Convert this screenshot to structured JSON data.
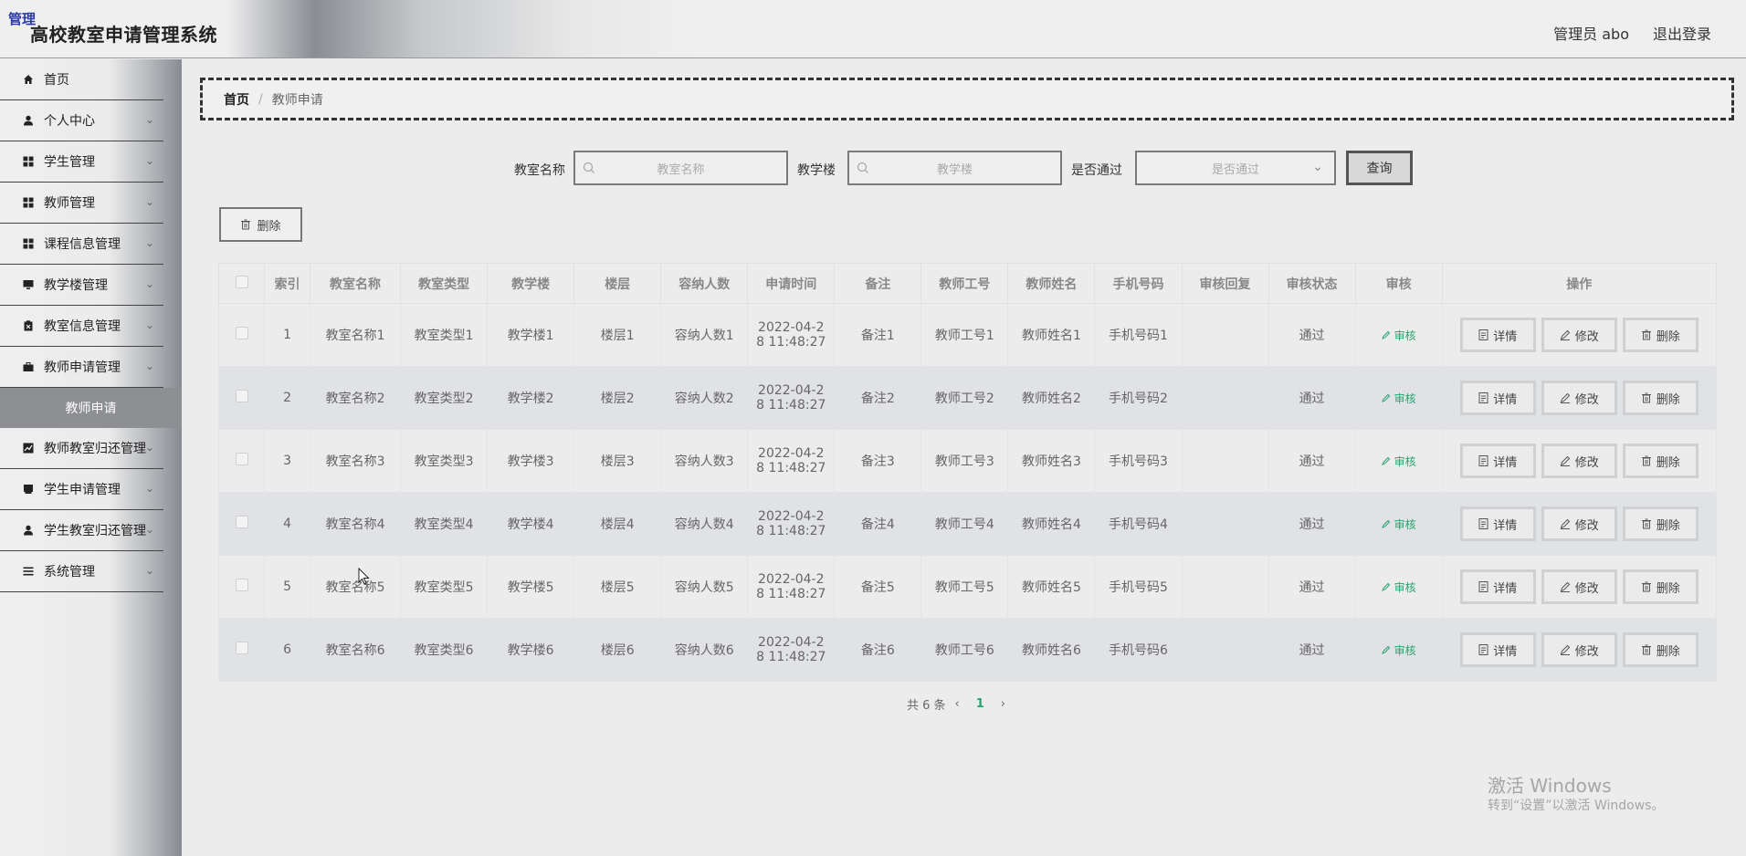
{
  "header": {
    "badge": "管理",
    "title": "高校教室申请管理系统",
    "user": "管理员 abo",
    "logout": "退出登录"
  },
  "sidebar": {
    "items": [
      {
        "label": "首页",
        "icon": "home-icon"
      },
      {
        "label": "个人中心",
        "icon": "user-icon"
      },
      {
        "label": "学生管理",
        "icon": "grid-icon"
      },
      {
        "label": "教师管理",
        "icon": "grid-icon"
      },
      {
        "label": "课程信息管理",
        "icon": "grid-icon"
      },
      {
        "label": "教学楼管理",
        "icon": "monitor-icon"
      },
      {
        "label": "教室信息管理",
        "icon": "clipboard-icon"
      },
      {
        "label": "教师申请管理",
        "icon": "briefcase-icon"
      }
    ],
    "sub_item": "教师申请",
    "items2": [
      {
        "label": "教师教室归还管理",
        "icon": "chart-icon"
      },
      {
        "label": "学生申请管理",
        "icon": "book-icon"
      },
      {
        "label": "学生教室归还管理",
        "icon": "user-icon"
      },
      {
        "label": "系统管理",
        "icon": "list-icon"
      }
    ]
  },
  "breadcrumb": {
    "home": "首页",
    "sep": "/",
    "current": "教师申请"
  },
  "search": {
    "name_label": "教室名称",
    "name_placeholder": "教室名称",
    "building_label": "教学楼",
    "building_placeholder": "教学楼",
    "pass_label": "是否通过",
    "pass_placeholder": "是否通过",
    "query": "查询"
  },
  "toolbar": {
    "delete": "删除"
  },
  "table": {
    "headers": [
      "索引",
      "教室名称",
      "教室类型",
      "教学楼",
      "楼层",
      "容纳人数",
      "申请时间",
      "备注",
      "教师工号",
      "教师姓名",
      "手机号码",
      "审核回复",
      "审核状态",
      "审核",
      "操作"
    ],
    "rows": [
      {
        "idx": "1",
        "name": "教室名称1",
        "type": "教室类型1",
        "building": "教学楼1",
        "floor": "楼层1",
        "cap": "容纳人数1",
        "time1": "2022-04-2",
        "time2": "8 11:48:27",
        "note": "备注1",
        "tid": "教师工号1",
        "tname": "教师姓名1",
        "phone": "手机号码1",
        "reply": "",
        "status": "通过"
      },
      {
        "idx": "2",
        "name": "教室名称2",
        "type": "教室类型2",
        "building": "教学楼2",
        "floor": "楼层2",
        "cap": "容纳人数2",
        "time1": "2022-04-2",
        "time2": "8 11:48:27",
        "note": "备注2",
        "tid": "教师工号2",
        "tname": "教师姓名2",
        "phone": "手机号码2",
        "reply": "",
        "status": "通过"
      },
      {
        "idx": "3",
        "name": "教室名称3",
        "type": "教室类型3",
        "building": "教学楼3",
        "floor": "楼层3",
        "cap": "容纳人数3",
        "time1": "2022-04-2",
        "time2": "8 11:48:27",
        "note": "备注3",
        "tid": "教师工号3",
        "tname": "教师姓名3",
        "phone": "手机号码3",
        "reply": "",
        "status": "通过"
      },
      {
        "idx": "4",
        "name": "教室名称4",
        "type": "教室类型4",
        "building": "教学楼4",
        "floor": "楼层4",
        "cap": "容纳人数4",
        "time1": "2022-04-2",
        "time2": "8 11:48:27",
        "note": "备注4",
        "tid": "教师工号4",
        "tname": "教师姓名4",
        "phone": "手机号码4",
        "reply": "",
        "status": "通过"
      },
      {
        "idx": "5",
        "name": "教室名称5",
        "type": "教室类型5",
        "building": "教学楼5",
        "floor": "楼层5",
        "cap": "容纳人数5",
        "time1": "2022-04-2",
        "time2": "8 11:48:27",
        "note": "备注5",
        "tid": "教师工号5",
        "tname": "教师姓名5",
        "phone": "手机号码5",
        "reply": "",
        "status": "通过"
      },
      {
        "idx": "6",
        "name": "教室名称6",
        "type": "教室类型6",
        "building": "教学楼6",
        "floor": "楼层6",
        "cap": "容纳人数6",
        "time1": "2022-04-2",
        "time2": "8 11:48:27",
        "note": "备注6",
        "tid": "教师工号6",
        "tname": "教师姓名6",
        "phone": "手机号码6",
        "reply": "",
        "status": "通过"
      }
    ],
    "audit_label": "审核",
    "btn_detail": "详情",
    "btn_edit": "修改",
    "btn_delete": "删除"
  },
  "pager": {
    "total": "共 6 条",
    "prev": "‹",
    "page": "1",
    "next": "›"
  },
  "watermark": {
    "line1": "激活 Windows",
    "line2": "转到“设置”以激活 Windows。"
  },
  "colors": {
    "accent": "#2aa36e",
    "sub_item_bg": "#8d8f93"
  }
}
